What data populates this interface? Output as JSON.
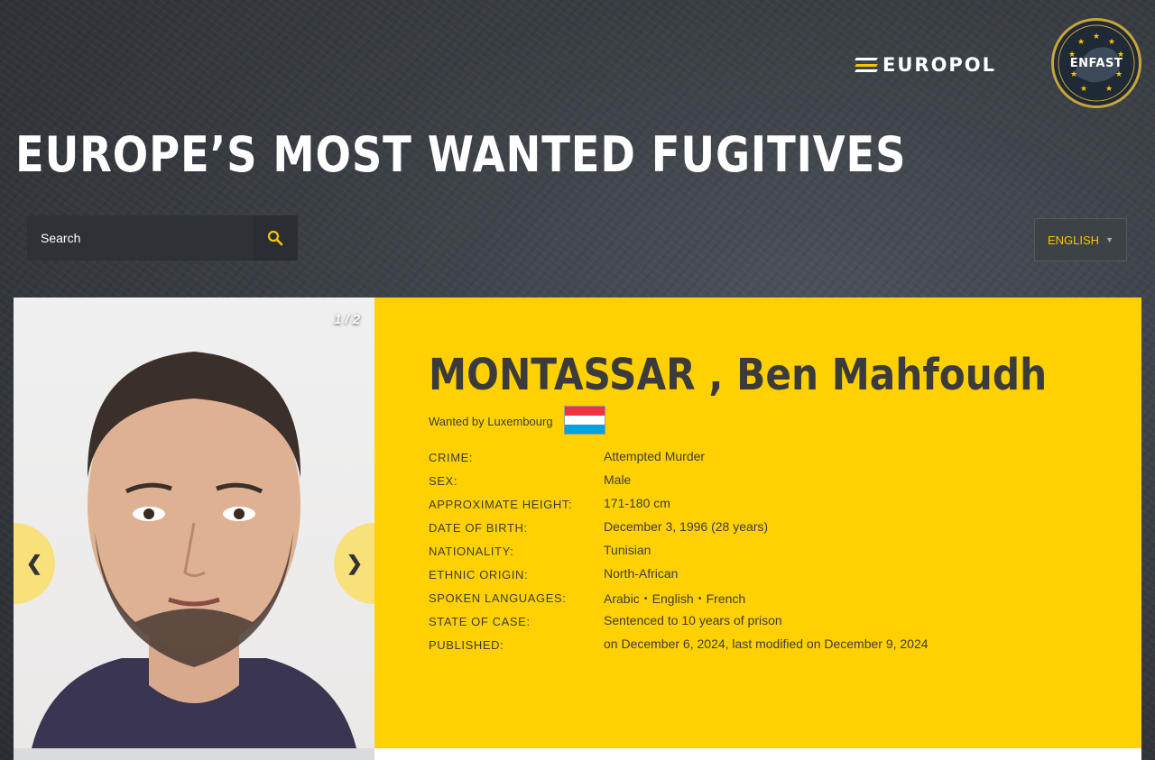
{
  "header": {
    "title": "EUROPE’S MOST WANTED FUGITIVES",
    "europol_logo_text": "EUROPOL",
    "enfast_logo_text": "ENFAST"
  },
  "search": {
    "placeholder": "Search",
    "value": "",
    "icon": "search-icon"
  },
  "language": {
    "selected": "ENGLISH"
  },
  "profile": {
    "photo_counter": "1 / 2",
    "prev_label": "❮",
    "next_label": "❯",
    "name": "MONTASSAR , Ben Mahfoudh",
    "wanted_by_label": "Wanted by",
    "wanted_by_country": "Luxembourg",
    "flag_colors": [
      "#ef3340",
      "#ffffff",
      "#00a3e0"
    ],
    "fields": [
      {
        "label": "CRIME:",
        "value": "Attempted Murder"
      },
      {
        "label": "SEX:",
        "value": "Male"
      },
      {
        "label": "APPROXIMATE HEIGHT:",
        "value": "171-180 cm"
      },
      {
        "label": "DATE OF BIRTH:",
        "value": "December 3, 1996 (28 years)"
      },
      {
        "label": "NATIONALITY:",
        "value": "Tunisian"
      },
      {
        "label": "ETHNIC ORIGIN:",
        "value": "North-African"
      },
      {
        "label": "SPOKEN LANGUAGES:",
        "value": "Arabic・English・French"
      },
      {
        "label": "STATE OF CASE:",
        "value": "Sentenced to 10 years of prison"
      },
      {
        "label": "PUBLISHED:",
        "value": "on December 6, 2024, last modified on December 9, 2024"
      }
    ]
  },
  "colors": {
    "accent": "#ffd102",
    "background": "#3a3f45",
    "lang_text": "#f5c400"
  }
}
